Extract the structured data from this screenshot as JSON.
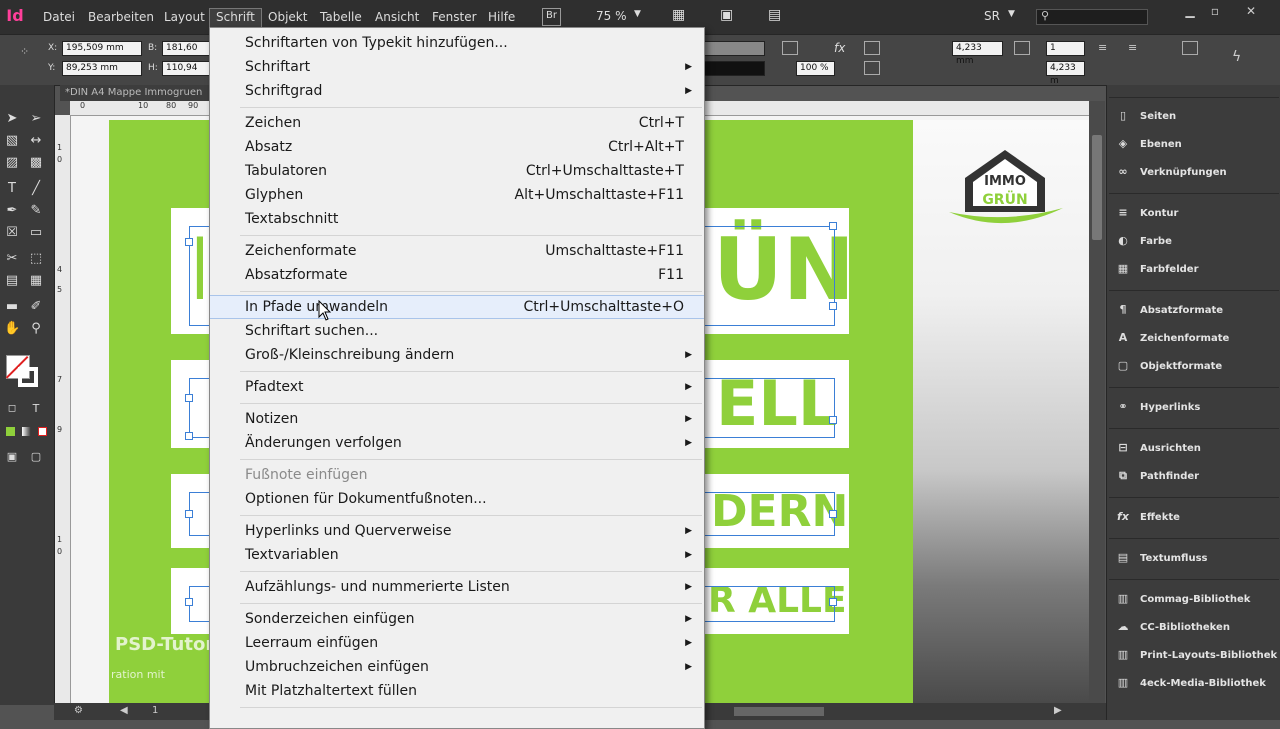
{
  "app": {
    "logo": "Id"
  },
  "menu": [
    "Datei",
    "Bearbeiten",
    "Layout",
    "Schrift",
    "Objekt",
    "Tabelle",
    "Ansicht",
    "Fenster",
    "Hilfe"
  ],
  "topbar": {
    "bridge": "Br",
    "zoom": "75 %",
    "workspace": "SR",
    "search_placeholder": ""
  },
  "control": {
    "x_label": "X:",
    "x_value": "195,509 mm",
    "y_label": "Y:",
    "y_value": "89,253 mm",
    "b_label": "B:",
    "b_value": "181,60",
    "h_label": "H:",
    "h_value": "110,94",
    "stroke_value": "4,233 mm",
    "stroke_value2": "4,233 m",
    "percent": "100 %",
    "cols": "1",
    "cols2": "1"
  },
  "document_tab": "*DIN A4 Mappe Immogruen",
  "ruler": {
    "h": [
      "0",
      "10",
      "80",
      "90"
    ],
    "v": [
      "1",
      "0",
      "4",
      "5",
      "7",
      "9",
      "1",
      "0"
    ]
  },
  "artwork": {
    "line1": "ÜN",
    "line2": "ELL",
    "line3": "DERN",
    "line4": "R ALLE",
    "logo_line1": "IMMO",
    "logo_line2": "GRÜN",
    "watermark1": "PSD-Tutori",
    "watermark2": "ration mit"
  },
  "schrift_menu": [
    {
      "label": "Schriftarten von Typekit hinzufügen...",
      "shortcut": ""
    },
    {
      "label": "Schriftart",
      "submenu": true
    },
    {
      "label": "Schriftgrad",
      "submenu": true
    },
    {
      "label": "Zeichen",
      "shortcut": "Ctrl+T"
    },
    {
      "label": "Absatz",
      "shortcut": "Ctrl+Alt+T"
    },
    {
      "label": "Tabulatoren",
      "shortcut": "Ctrl+Umschalttaste+T"
    },
    {
      "label": "Glyphen",
      "shortcut": "Alt+Umschalttaste+F11"
    },
    {
      "label": "Textabschnitt",
      "shortcut": ""
    },
    {
      "label": "Zeichenformate",
      "shortcut": "Umschalttaste+F11"
    },
    {
      "label": "Absatzformate",
      "shortcut": "F11"
    },
    {
      "label": "In Pfade umwandeln",
      "shortcut": "Ctrl+Umschalttaste+O"
    },
    {
      "label": "Schriftart suchen...",
      "shortcut": ""
    },
    {
      "label": "Groß-/Kleinschreibung ändern",
      "submenu": true
    },
    {
      "label": "Pfadtext",
      "submenu": true
    },
    {
      "label": "Notizen",
      "submenu": true
    },
    {
      "label": "Änderungen verfolgen",
      "submenu": true
    },
    {
      "label": "Fußnote einfügen",
      "disabled": true
    },
    {
      "label": "Optionen für Dokumentfußnoten...",
      "shortcut": ""
    },
    {
      "label": "Hyperlinks und Querverweise",
      "submenu": true
    },
    {
      "label": "Textvariablen",
      "submenu": true
    },
    {
      "label": "Aufzählungs- und nummerierte Listen",
      "submenu": true
    },
    {
      "label": "Sonderzeichen einfügen",
      "submenu": true
    },
    {
      "label": "Leerraum einfügen",
      "submenu": true
    },
    {
      "label": "Umbruchzeichen einfügen",
      "submenu": true
    },
    {
      "label": "Mit Platzhaltertext füllen",
      "shortcut": ""
    }
  ],
  "panels": [
    "Seiten",
    "Ebenen",
    "Verknüpfungen",
    "Kontur",
    "Farbe",
    "Farbfelder",
    "Absatzformate",
    "Zeichenformate",
    "Objektformate",
    "Hyperlinks",
    "Ausrichten",
    "Pathfinder",
    "Effekte",
    "Textumfluss",
    "Commag-Bibliothek",
    "CC-Bibliotheken",
    "Print-Layouts-Bibliothek",
    "4eck-Media-Bibliothek"
  ],
  "status": {
    "page": "1"
  }
}
